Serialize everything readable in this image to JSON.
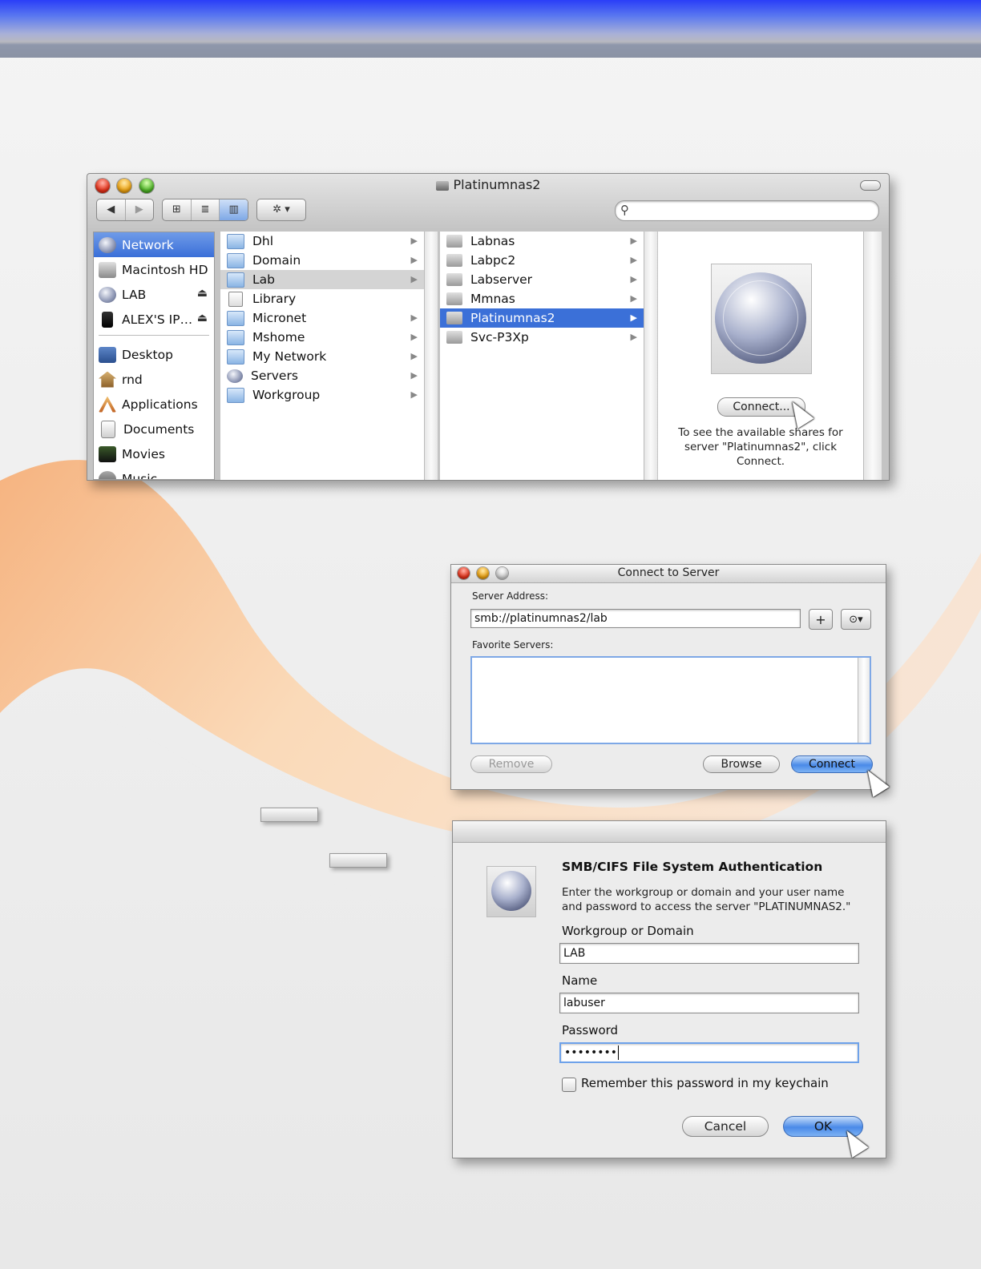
{
  "finder": {
    "title": "Platinumnas2",
    "toolbar": {
      "back_label": "◀",
      "forward_label": "▶",
      "view_icon": "⊞",
      "view_list": "≣",
      "view_columns": "▥",
      "action_label": "✲ ▾",
      "search_placeholder": ""
    },
    "sidebar": {
      "devices": [
        {
          "label": "Network",
          "icon": "network-globe-icon"
        },
        {
          "label": "Macintosh HD",
          "icon": "hard-drive-icon"
        },
        {
          "label": "LAB",
          "icon": "network-share-icon"
        },
        {
          "label": "ALEX'S IP…",
          "icon": "ipod-icon"
        }
      ],
      "places": [
        {
          "label": "Desktop",
          "icon": "desktop-icon"
        },
        {
          "label": "rnd",
          "icon": "home-icon"
        },
        {
          "label": "Applications",
          "icon": "applications-icon"
        },
        {
          "label": "Documents",
          "icon": "documents-icon"
        },
        {
          "label": "Movies",
          "icon": "movies-icon"
        },
        {
          "label": "Music",
          "icon": "music-icon"
        }
      ]
    },
    "column1": [
      "Dhl",
      "Domain",
      "Lab",
      "Library",
      "Micronet",
      "Mshome",
      "My Network",
      "Servers",
      "Workgroup"
    ],
    "column2": [
      "Labnas",
      "Labpc2",
      "Labserver",
      "Mmnas",
      "Platinumnas2",
      "Svc-P3Xp"
    ],
    "preview": {
      "connect_button": "Connect...",
      "text": "To see the available shares for server \"Platinumnas2\", click Connect."
    }
  },
  "connect_dialog": {
    "title": "Connect to Server",
    "server_address_label": "Server Address:",
    "server_address_value": "smb://platinumnas2/lab",
    "add_button": "+",
    "recent_button": "⊙▾",
    "favorites_label": "Favorite Servers:",
    "remove_button": "Remove",
    "browse_button": "Browse",
    "connect_button": "Connect"
  },
  "auth_dialog": {
    "heading": "SMB/CIFS File System Authentication",
    "description": "Enter the workgroup or domain and your user name and password to access the server \"PLATINUMNAS2.\"",
    "workgroup_label": "Workgroup or Domain",
    "workgroup_value": "LAB",
    "name_label": "Name",
    "name_value": "labuser",
    "password_label": "Password",
    "password_value": "••••••••",
    "remember_label": "Remember this password in my keychain",
    "cancel_button": "Cancel",
    "ok_button": "OK"
  }
}
